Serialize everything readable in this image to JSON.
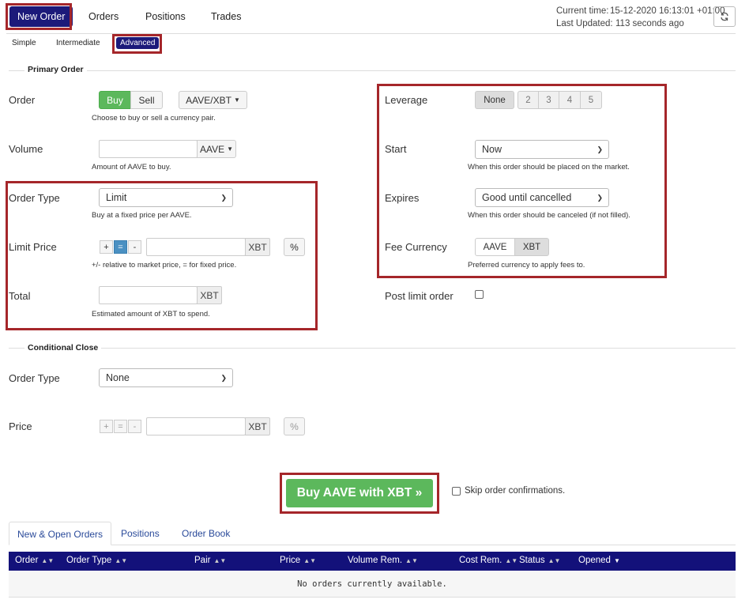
{
  "nav": {
    "tabs": [
      {
        "label": "New Order"
      },
      {
        "label": "Orders"
      },
      {
        "label": "Positions"
      },
      {
        "label": "Trades"
      }
    ],
    "current_time_label": "Current time:",
    "current_time_value": "15-12-2020 16:13:01 +01:00",
    "last_updated_label": "Last Updated:",
    "last_updated_value": "113 seconds ago"
  },
  "subtabs": [
    {
      "label": "Simple"
    },
    {
      "label": "Intermediate"
    },
    {
      "label": "Advanced"
    }
  ],
  "primary": {
    "heading": "Primary Order",
    "order_label": "Order",
    "buy_label": "Buy",
    "sell_label": "Sell",
    "pair_label": "AAVE/XBT",
    "order_help": "Choose to buy or sell a currency pair.",
    "volume_label": "Volume",
    "volume_value": "",
    "volume_unit": "AAVE",
    "volume_help": "Amount of AAVE to buy.",
    "order_type_label": "Order Type",
    "order_type_value": "Limit",
    "order_type_help": "Buy at a fixed price per AAVE.",
    "limit_price_label": "Limit Price",
    "limit_price_value": "",
    "limit_price_unit": "XBT",
    "percent_label": "%",
    "limit_help": "+/- relative to market price, = for fixed price.",
    "total_label": "Total",
    "total_value": "",
    "total_unit": "XBT",
    "total_help": "Estimated amount of XBT to spend."
  },
  "right": {
    "leverage_label": "Leverage",
    "leverage_options": [
      "None",
      "2",
      "3",
      "4",
      "5"
    ],
    "start_label": "Start",
    "start_value": "Now",
    "start_help": "When this order should be placed on the market.",
    "expires_label": "Expires",
    "expires_value": "Good until cancelled",
    "expires_help": "When this order should be canceled (if not filled).",
    "fee_label": "Fee Currency",
    "fee_options": [
      "AAVE",
      "XBT"
    ],
    "fee_help": "Preferred currency to apply fees to.",
    "post_limit_label": "Post limit order"
  },
  "conditional": {
    "heading": "Conditional Close",
    "order_type_label": "Order Type",
    "order_type_value": "None",
    "price_label": "Price",
    "price_value": "",
    "price_unit": "XBT",
    "percent_label": "%"
  },
  "submit": {
    "label": "Buy AAVE with XBT »",
    "skip_label": "Skip order confirmations."
  },
  "bottom_tabs": [
    {
      "label": "New & Open Orders"
    },
    {
      "label": "Positions"
    },
    {
      "label": "Order Book"
    }
  ],
  "table": {
    "columns": [
      "Order",
      "Order Type",
      "Pair",
      "Price",
      "Volume Rem.",
      "Cost Rem.",
      "Status",
      "Opened"
    ],
    "empty_message": "No orders currently available."
  },
  "colors": {
    "brand_navy": "#1c1a7a",
    "buy_green": "#5cb85c",
    "highlight_red": "#a5262a"
  }
}
